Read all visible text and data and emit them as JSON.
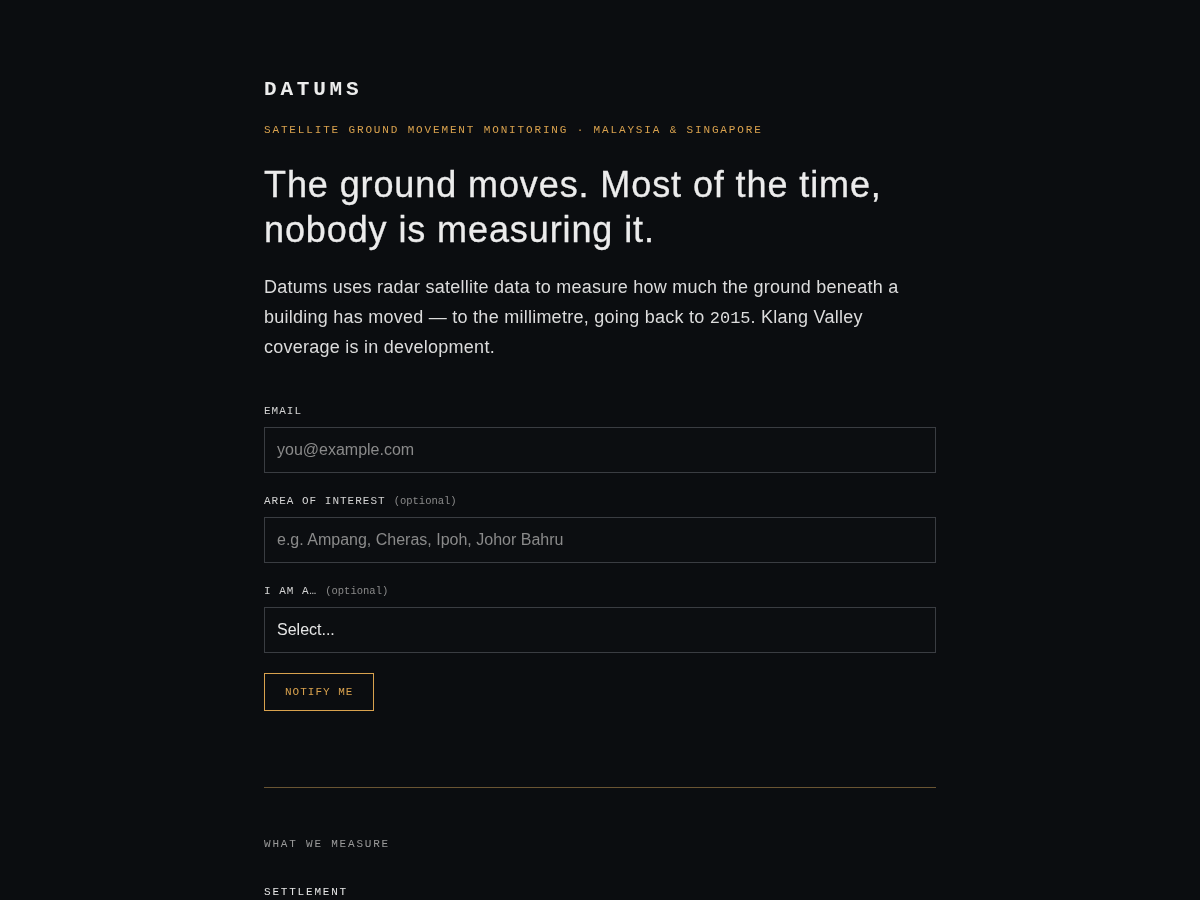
{
  "brand": {
    "name": "DATUMS",
    "tagline": "SATELLITE GROUND MOVEMENT MONITORING · MALAYSIA & SINGAPORE"
  },
  "hero": {
    "heading": "The ground moves. Most of the time, nobody is measuring it.",
    "intro": [
      {
        "kind": "text",
        "text": "Datums uses radar satellite data to measure how much the ground beneath a building has moved — to the millimetre, going back to "
      },
      {
        "kind": "code",
        "text": "2015"
      },
      {
        "kind": "text",
        "text": ". Klang Valley coverage is in development."
      }
    ]
  },
  "form": {
    "fields": [
      {
        "kind": "input",
        "label": "EMAIL",
        "placeholder": "you@example.com"
      },
      {
        "kind": "input",
        "label": "AREA OF INTEREST",
        "note": "(optional)",
        "placeholder": "e.g. Ampang, Cheras, Ipoh, Johor Bahru"
      },
      {
        "kind": "select",
        "label": "I AM A…",
        "note": "(optional)",
        "value": "Select..."
      }
    ],
    "submit": "NOTIFY ME"
  },
  "section": {
    "eyebrow": "WHAT WE MEASURE",
    "items": [
      {
        "title": "SETTLEMENT"
      }
    ]
  }
}
